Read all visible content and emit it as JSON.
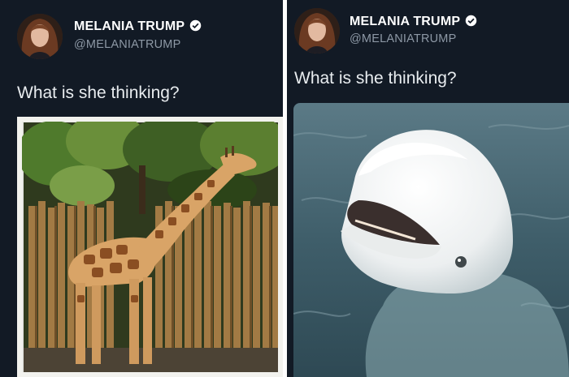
{
  "left_tweet": {
    "user": {
      "name": "MELANIA TRUMP",
      "handle": "@MELANIATRUMP",
      "verified": true
    },
    "text": "What is she thinking?",
    "media": {
      "subject": "giraffe"
    }
  },
  "right_tweet": {
    "user": {
      "name": "MELANIA TRUMP",
      "handle": "@MELANIATRUMP",
      "verified": true
    },
    "text": "What is she thinking?",
    "media": {
      "subject": "beluga whale"
    }
  },
  "colors": {
    "background": "#121a25",
    "name": "#ffffff",
    "handle": "#8d98a5",
    "tweet_text": "#e8ecef",
    "badge": "#ffffff"
  },
  "icons": {
    "verified": "verified-badge-icon",
    "avatar": "avatar"
  }
}
